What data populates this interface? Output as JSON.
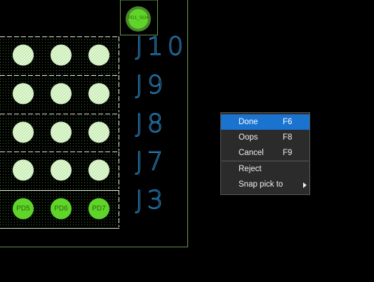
{
  "pcb": {
    "ref_labels": [
      "J10",
      "J9",
      "J8",
      "J7",
      "J3"
    ],
    "top_pad_label": "PD1_SO4",
    "bottom_pad_labels": [
      "PD5",
      "PD6",
      "PD7"
    ]
  },
  "context_menu": {
    "items": [
      {
        "label": "Done",
        "shortcut": "F6",
        "highlighted": true
      },
      {
        "label": "Oops",
        "shortcut": "F8"
      },
      {
        "label": "Cancel",
        "shortcut": "F9"
      },
      {
        "label": "Reject"
      },
      {
        "label": "Snap pick to",
        "has_submenu": true
      }
    ]
  },
  "colors": {
    "background": "#000000",
    "board_outline": "#6c9c4c",
    "pad_green": "#5fd42a",
    "pad_hatch": "#d8f2c8",
    "ref_text": "#2f8fd0",
    "menu_background": "#2b2b2b",
    "menu_highlight": "#1b73d0"
  }
}
